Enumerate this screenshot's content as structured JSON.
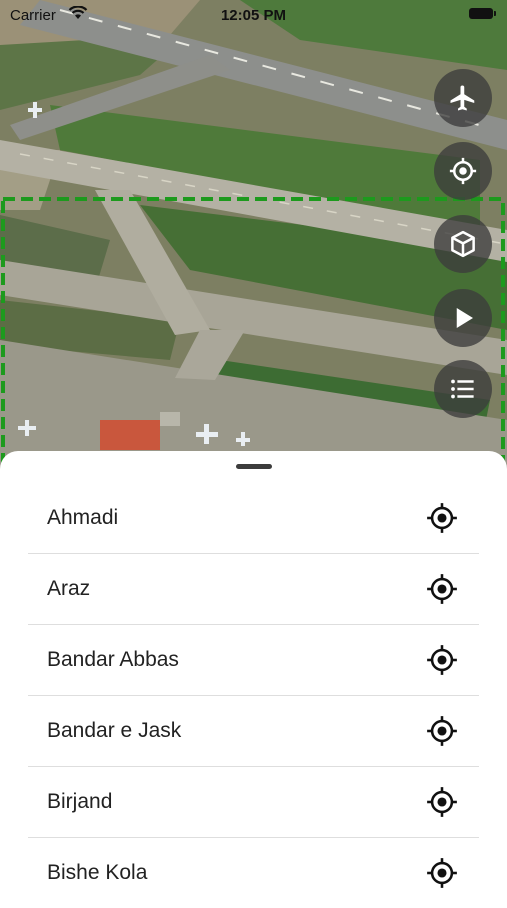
{
  "status_bar": {
    "carrier": "Carrier",
    "time": "12:05 PM"
  },
  "map": {
    "style": "satellite",
    "selection_color": "#1d9a1d"
  },
  "map_controls": [
    {
      "name": "flight-button",
      "icon": "airplane-icon"
    },
    {
      "name": "locate-button",
      "icon": "crosshair-icon"
    },
    {
      "name": "3d-view-button",
      "icon": "cube-icon"
    },
    {
      "name": "play-button",
      "icon": "play-icon"
    },
    {
      "name": "list-button",
      "icon": "list-icon"
    }
  ],
  "sheet": {
    "airports": [
      {
        "name": "Ahmadi"
      },
      {
        "name": "Araz"
      },
      {
        "name": "Bandar Abbas"
      },
      {
        "name": "Bandar e Jask"
      },
      {
        "name": "Birjand"
      },
      {
        "name": "Bishe Kola"
      }
    ]
  }
}
